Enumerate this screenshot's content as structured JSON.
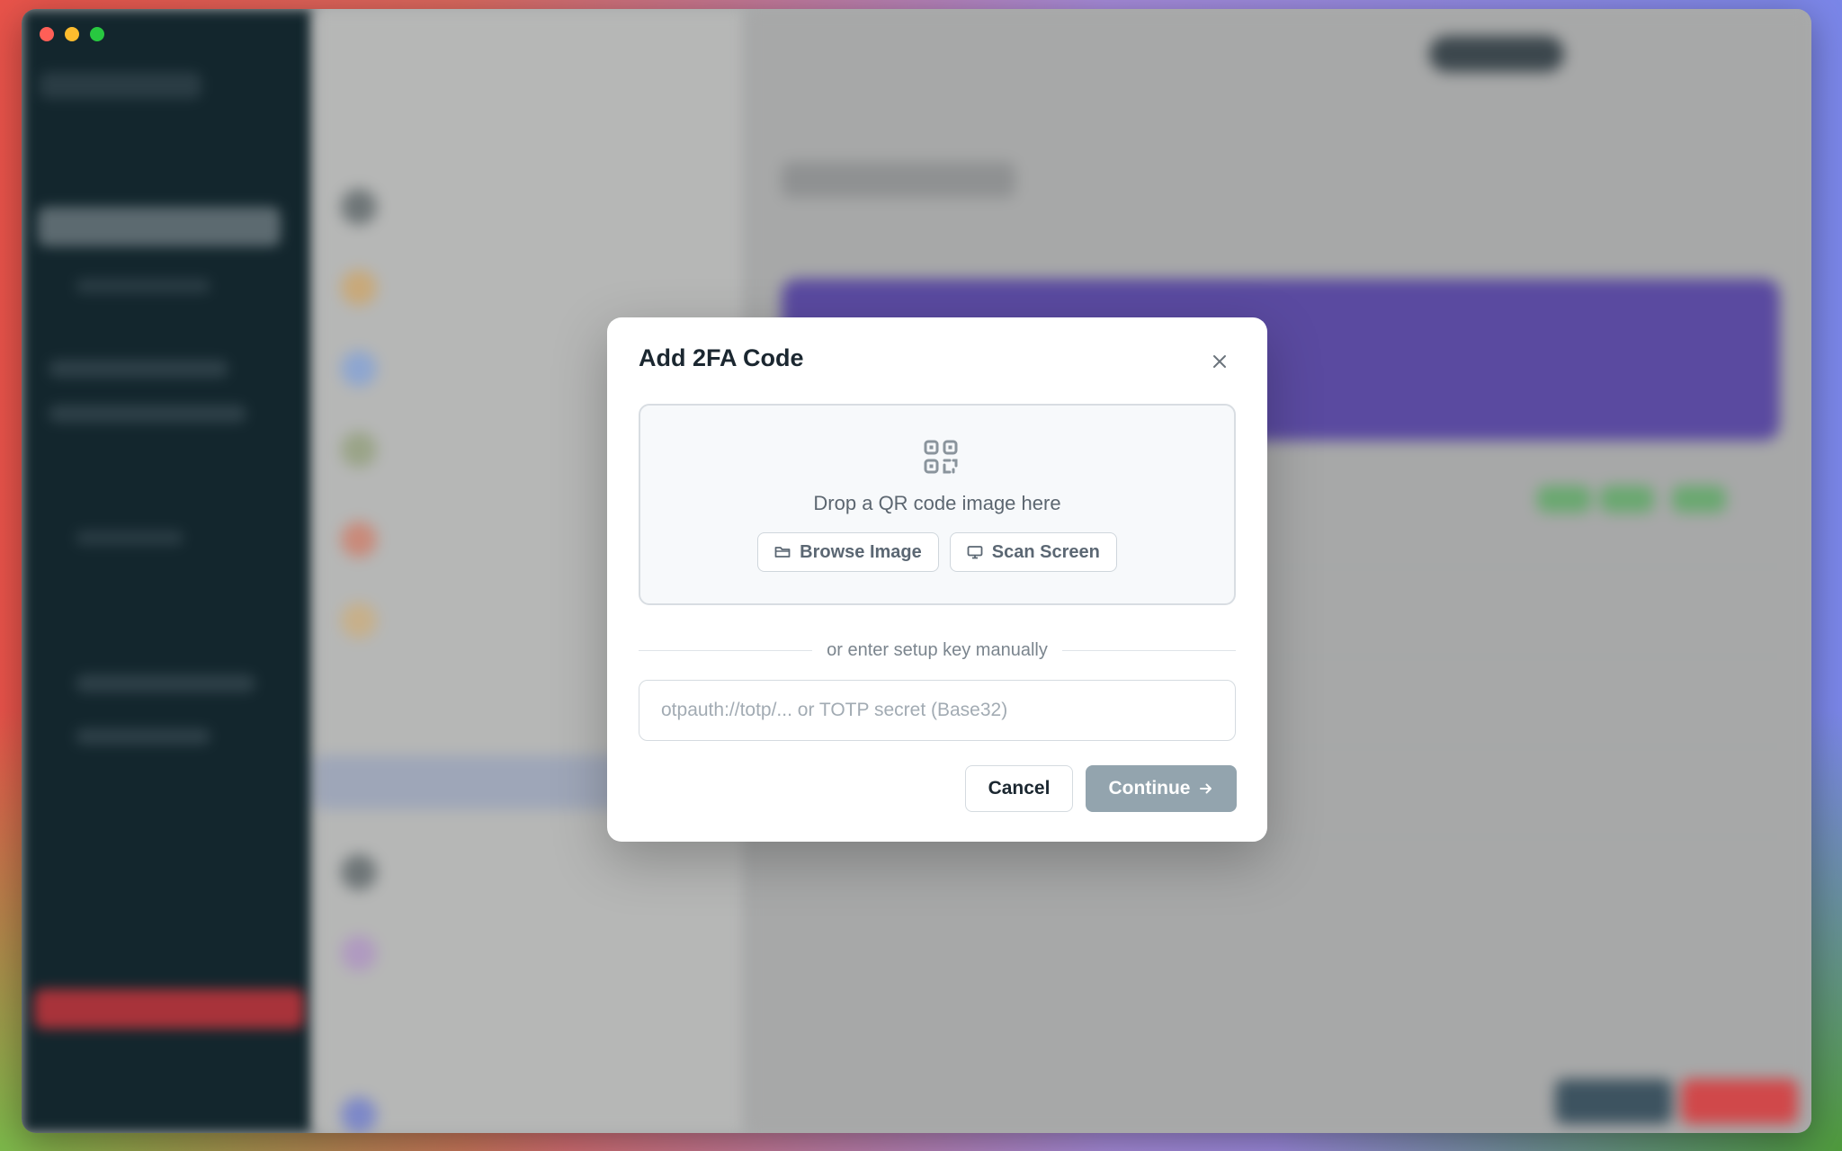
{
  "modal": {
    "title": "Add 2FA Code",
    "close_icon": "close-icon",
    "dropzone": {
      "icon": "qr-code-icon",
      "text": "Drop a QR code image here",
      "browse_label": "Browse Image",
      "browse_icon": "folder-icon",
      "scan_label": "Scan Screen",
      "scan_icon": "monitor-icon"
    },
    "divider_text": "or enter setup key manually",
    "key_input": {
      "value": "",
      "placeholder": "otpauth://totp/... or TOTP secret (Base32)"
    },
    "cancel_label": "Cancel",
    "continue_label": "Continue",
    "continue_icon": "arrow-right-icon"
  },
  "colors": {
    "continue_disabled": "#93a4ae",
    "sidebar_dark": "#13262d",
    "banner_purple": "#5a4aa0",
    "danger_red": "#e0494a"
  }
}
